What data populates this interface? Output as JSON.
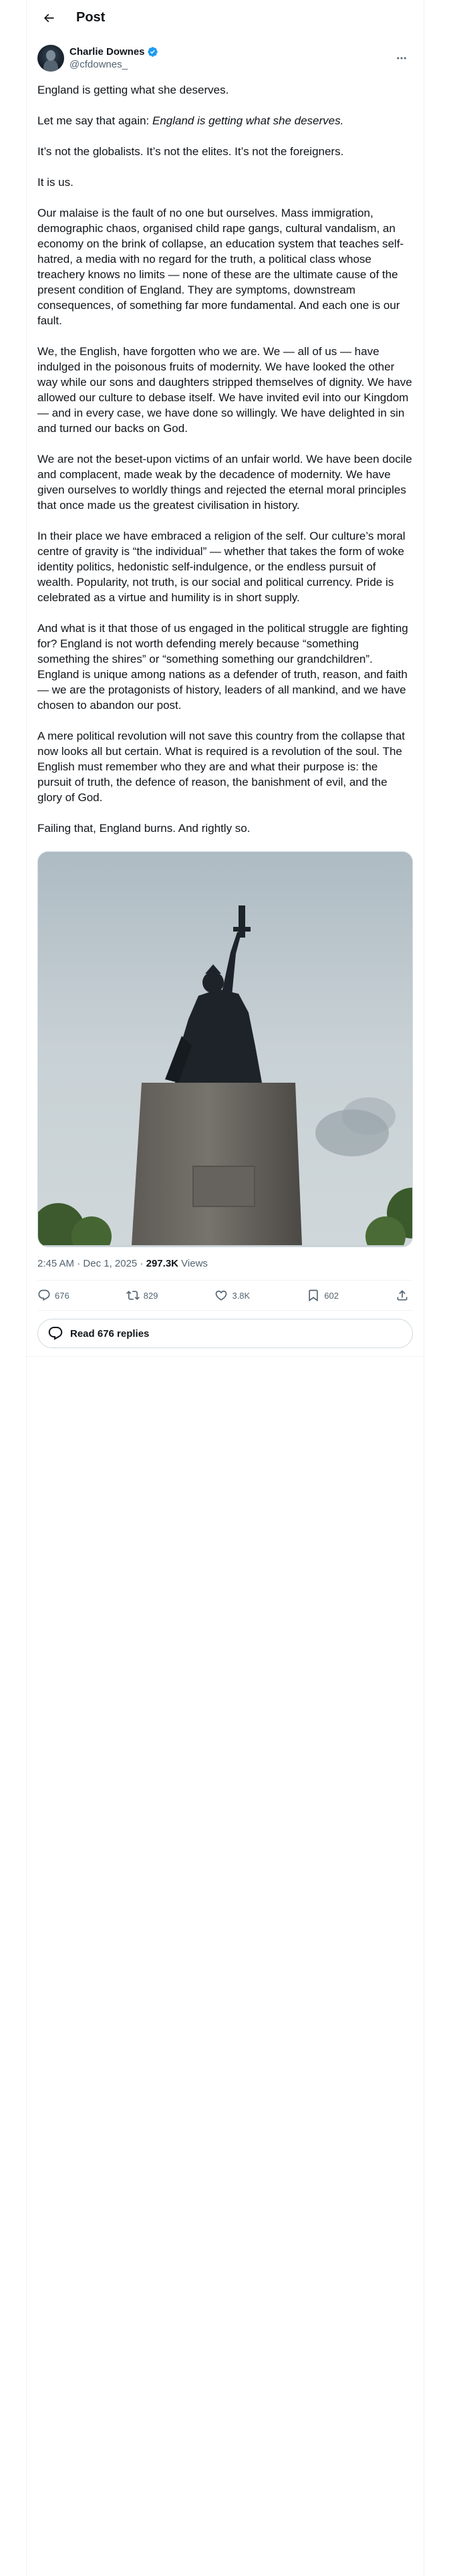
{
  "header": {
    "title": "Post"
  },
  "author": {
    "name": "Charlie Downes",
    "handle": "@cfdownes_"
  },
  "post": {
    "p1": "England is getting what she deserves.",
    "p2_prefix": "Let me say that again: ",
    "p2_em": "England is getting what she deserves.",
    "p3": "It’s not the globalists. It’s not the elites. It’s not the foreigners.",
    "p4": "It is us.",
    "p5": "Our malaise is the fault of no one but ourselves. Mass immigration, demographic chaos, organised child rape gangs, cultural vandalism, an economy on the brink of collapse, an education system that teaches self-hatred, a media with no regard for the truth, a political class whose treachery knows no limits — none of these are the ultimate cause of the present condition of England. They are symptoms, downstream consequences, of something far more fundamental. And each one is our fault.",
    "p6": "We, the English, have forgotten who we are. We — all of us — have indulged in the poisonous fruits of modernity. We have looked the other way while our sons and daughters stripped themselves of dignity. We have allowed our culture to debase itself. We have invited evil into our Kingdom — and in every case, we have done so willingly. We have delighted in sin and turned our backs on God.",
    "p7": "We are not the beset-upon victims of an unfair world. We have been docile and complacent, made weak by the decadence of modernity. We have given ourselves to worldly things and rejected the eternal moral principles that once made us the greatest civilisation in history.",
    "p8": "In their place we have embraced a religion of the self. Our culture’s moral centre of gravity is “the individual” — whether that takes the form of woke identity politics, hedonistic self-indulgence, or the endless pursuit of wealth. Popularity, not truth, is our social and political currency. Pride is celebrated as a virtue and humility is in short supply.",
    "p9": "And what is it that those of us engaged in the political struggle are fighting for? England is not worth defending merely because “something something the shires” or “something something our grandchildren”. England is unique among nations as a defender of truth, reason, and faith — we are the protagonists of history, leaders of all mankind, and we have chosen to abandon our post.",
    "p10": "A mere political revolution will not save this country from the collapse that now looks all but certain. What is required is a revolution of the soul. The English must remember who they are and what their purpose is: the pursuit of truth, the defence of reason, the banishment of evil, and the glory of God.",
    "p11": "Failing that, England burns. And rightly so."
  },
  "meta": {
    "time": "2:45 AM",
    "sep": " · ",
    "date": "Dec 1, 2025",
    "sep2": " · ",
    "views_count": "297.3K",
    "views_label": " Views"
  },
  "actions": {
    "replies": "676",
    "reposts": "829",
    "likes": "3.8K",
    "bookmarks": "602"
  },
  "replies_button": {
    "label": "Read 676 replies"
  },
  "icons": {
    "back": "arrow-left-icon",
    "verified": "verified-badge-icon",
    "more": "more-horizontal-icon",
    "reply": "reply-icon",
    "repost": "repost-icon",
    "like": "heart-icon",
    "bookmark": "bookmark-icon",
    "share": "share-icon"
  },
  "colors": {
    "text": "#0f1419",
    "secondary": "#536471",
    "verified": "#1d9bf0",
    "border": "#eff3f4"
  }
}
